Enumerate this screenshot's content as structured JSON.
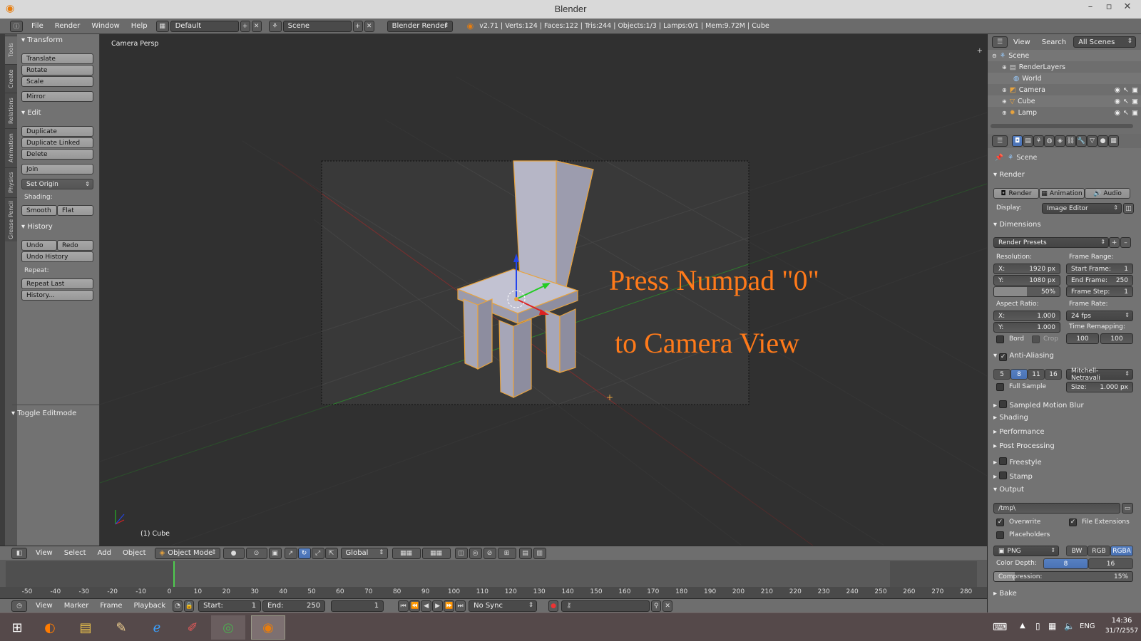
{
  "window": {
    "title": "Blender"
  },
  "menu": [
    "File",
    "Render",
    "Window",
    "Help"
  ],
  "layout": "Default",
  "scene": "Scene",
  "engine": "Blender Render",
  "stats": "v2.71 | Verts:124 | Faces:122 | Tris:244 | Objects:1/3 | Lamps:0/1 | Mem:9.72M | Cube",
  "tabs": [
    "Tools",
    "Create",
    "Relations",
    "Animation",
    "Physics",
    "Grease Pencil"
  ],
  "tools": {
    "transform": {
      "header": "Transform",
      "buttons": [
        "Translate",
        "Rotate",
        "Scale",
        "Mirror"
      ]
    },
    "edit": {
      "header": "Edit",
      "buttons": [
        "Duplicate",
        "Duplicate Linked",
        "Delete",
        "Join"
      ],
      "set_origin": "Set Origin",
      "shading_label": "Shading:",
      "smooth": "Smooth",
      "flat": "Flat"
    },
    "history": {
      "header": "History",
      "undo": "Undo",
      "redo": "Redo",
      "undo_history": "Undo History",
      "repeat_label": "Repeat:",
      "repeat_last": "Repeat Last",
      "history": "History..."
    },
    "toggle_editmode": "Toggle Editmode"
  },
  "viewport": {
    "label": "Camera Persp",
    "object_label": "(1) Cube",
    "overlay_line1": "Press Numpad \"0\"",
    "overlay_line2": "to Camera View"
  },
  "vtoolbar": {
    "menus": [
      "View",
      "Select",
      "Add",
      "Object"
    ],
    "mode": "Object Mode",
    "orientation": "Global"
  },
  "timeline": {
    "ticks": [
      "-50",
      "-40",
      "-30",
      "-20",
      "-10",
      "0",
      "10",
      "20",
      "30",
      "40",
      "50",
      "60",
      "70",
      "80",
      "90",
      "100",
      "110",
      "120",
      "130",
      "140",
      "150",
      "160",
      "170",
      "180",
      "190",
      "200",
      "210",
      "220",
      "230",
      "240",
      "250",
      "260",
      "270",
      "280"
    ]
  },
  "timebar": {
    "menus": [
      "View",
      "Marker",
      "Frame",
      "Playback"
    ],
    "start_label": "Start:",
    "start": "1",
    "end_label": "End:",
    "end": "250",
    "current": "1",
    "sync": "No Sync"
  },
  "outliner": {
    "menus": [
      "View",
      "Search"
    ],
    "filter": "All Scenes",
    "items": [
      "Scene",
      "RenderLayers",
      "World",
      "Camera",
      "Cube",
      "Lamp"
    ]
  },
  "props": {
    "breadcrumb": "Scene",
    "render": {
      "header": "Render",
      "render_btn": "Render",
      "animation_btn": "Animation",
      "audio_btn": "Audio",
      "display_label": "Display:",
      "display": "Image Editor"
    },
    "dimensions": {
      "header": "Dimensions",
      "presets": "Render Presets",
      "resolution_label": "Resolution:",
      "res_x": "X:",
      "res_x_val": "1920 px",
      "res_y": "Y:",
      "res_y_val": "1080 px",
      "res_pct": "50%",
      "frame_range_label": "Frame Range:",
      "start_frame": "Start Frame:",
      "start_frame_val": "1",
      "end_frame": "End Frame:",
      "end_frame_val": "250",
      "frame_step": "Frame Step:",
      "frame_step_val": "1",
      "aspect_label": "Aspect Ratio:",
      "asp_x": "X:",
      "asp_x_val": "1.000",
      "asp_y": "Y:",
      "asp_y_val": "1.000",
      "frame_rate_label": "Frame Rate:",
      "frame_rate": "24 fps",
      "time_remap_label": "Time Remapping:",
      "remap_old": "100",
      "remap_new": "100",
      "bord": "Bord",
      "crop": "Crop"
    },
    "aa": {
      "header": "Anti-Aliasing",
      "samples": [
        "5",
        "8",
        "11",
        "16"
      ],
      "filter": "Mitchell-Netravali",
      "full_sample": "Full Sample",
      "size_label": "Size:",
      "size_val": "1.000 px"
    },
    "collapsed": [
      "Sampled Motion Blur",
      "Shading",
      "Performance",
      "Post Processing",
      "Freestyle",
      "Stamp"
    ],
    "output": {
      "header": "Output",
      "path": "/tmp\\",
      "overwrite": "Overwrite",
      "file_ext": "File Extensions",
      "placeholders": "Placeholders",
      "format": "PNG",
      "bw": "BW",
      "rgb": "RGB",
      "rgba": "RGBA",
      "color_depth_label": "Color Depth:",
      "depth8": "8",
      "depth16": "16",
      "compression_label": "Compression:",
      "compression_val": "15%"
    },
    "bake": "Bake"
  },
  "taskbar": {
    "lang": "ENG",
    "time": "14:36",
    "date": "31/7/2557"
  }
}
